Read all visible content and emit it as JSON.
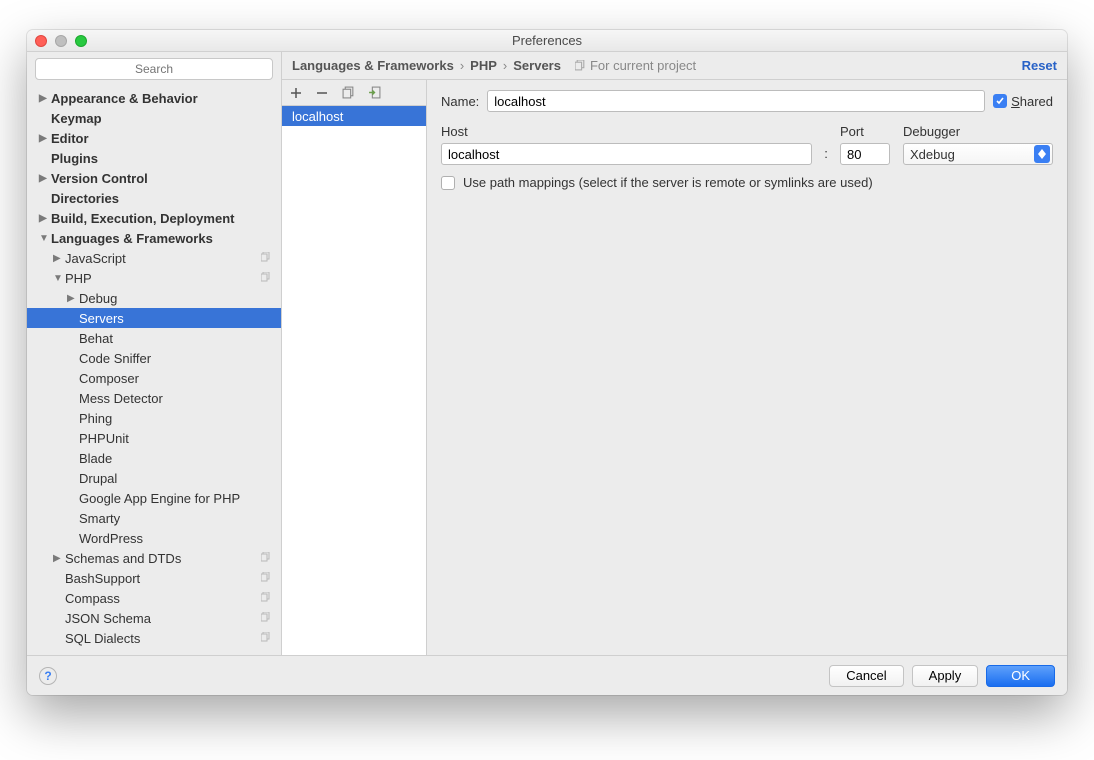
{
  "window_title": "Preferences",
  "search_placeholder": "Search",
  "breadcrumb": {
    "a": "Languages & Frameworks",
    "b": "PHP",
    "c": "Servers"
  },
  "scope_text": "For current project",
  "reset_label": "Reset",
  "sidebar": {
    "appearance": "Appearance & Behavior",
    "keymap": "Keymap",
    "editor": "Editor",
    "plugins": "Plugins",
    "version_control": "Version Control",
    "directories": "Directories",
    "build": "Build, Execution, Deployment",
    "langs": "Languages & Frameworks",
    "javascript": "JavaScript",
    "php": "PHP",
    "php_debug": "Debug",
    "php_servers": "Servers",
    "php_behat": "Behat",
    "php_codesniffer": "Code Sniffer",
    "php_composer": "Composer",
    "php_mess": "Mess Detector",
    "php_phing": "Phing",
    "php_phpunit": "PHPUnit",
    "php_blade": "Blade",
    "php_drupal": "Drupal",
    "php_gae": "Google App Engine for PHP",
    "php_smarty": "Smarty",
    "php_wordpress": "WordPress",
    "schemas": "Schemas and DTDs",
    "bash": "BashSupport",
    "compass": "Compass",
    "json": "JSON Schema",
    "sql": "SQL Dialects"
  },
  "servers": {
    "selected": "localhost"
  },
  "form": {
    "name_label": "Name:",
    "name_value": "localhost",
    "shared_label": "hared",
    "host_label": "Host",
    "host_value": "localhost",
    "port_label": "Port",
    "port_value": "80",
    "debugger_label": "Debugger",
    "debugger_value": "Xdebug",
    "pathmap_label": "Use path mappings (select if the server is remote or symlinks are used)"
  },
  "footer": {
    "cancel": "Cancel",
    "apply": "Apply",
    "ok": "OK"
  }
}
